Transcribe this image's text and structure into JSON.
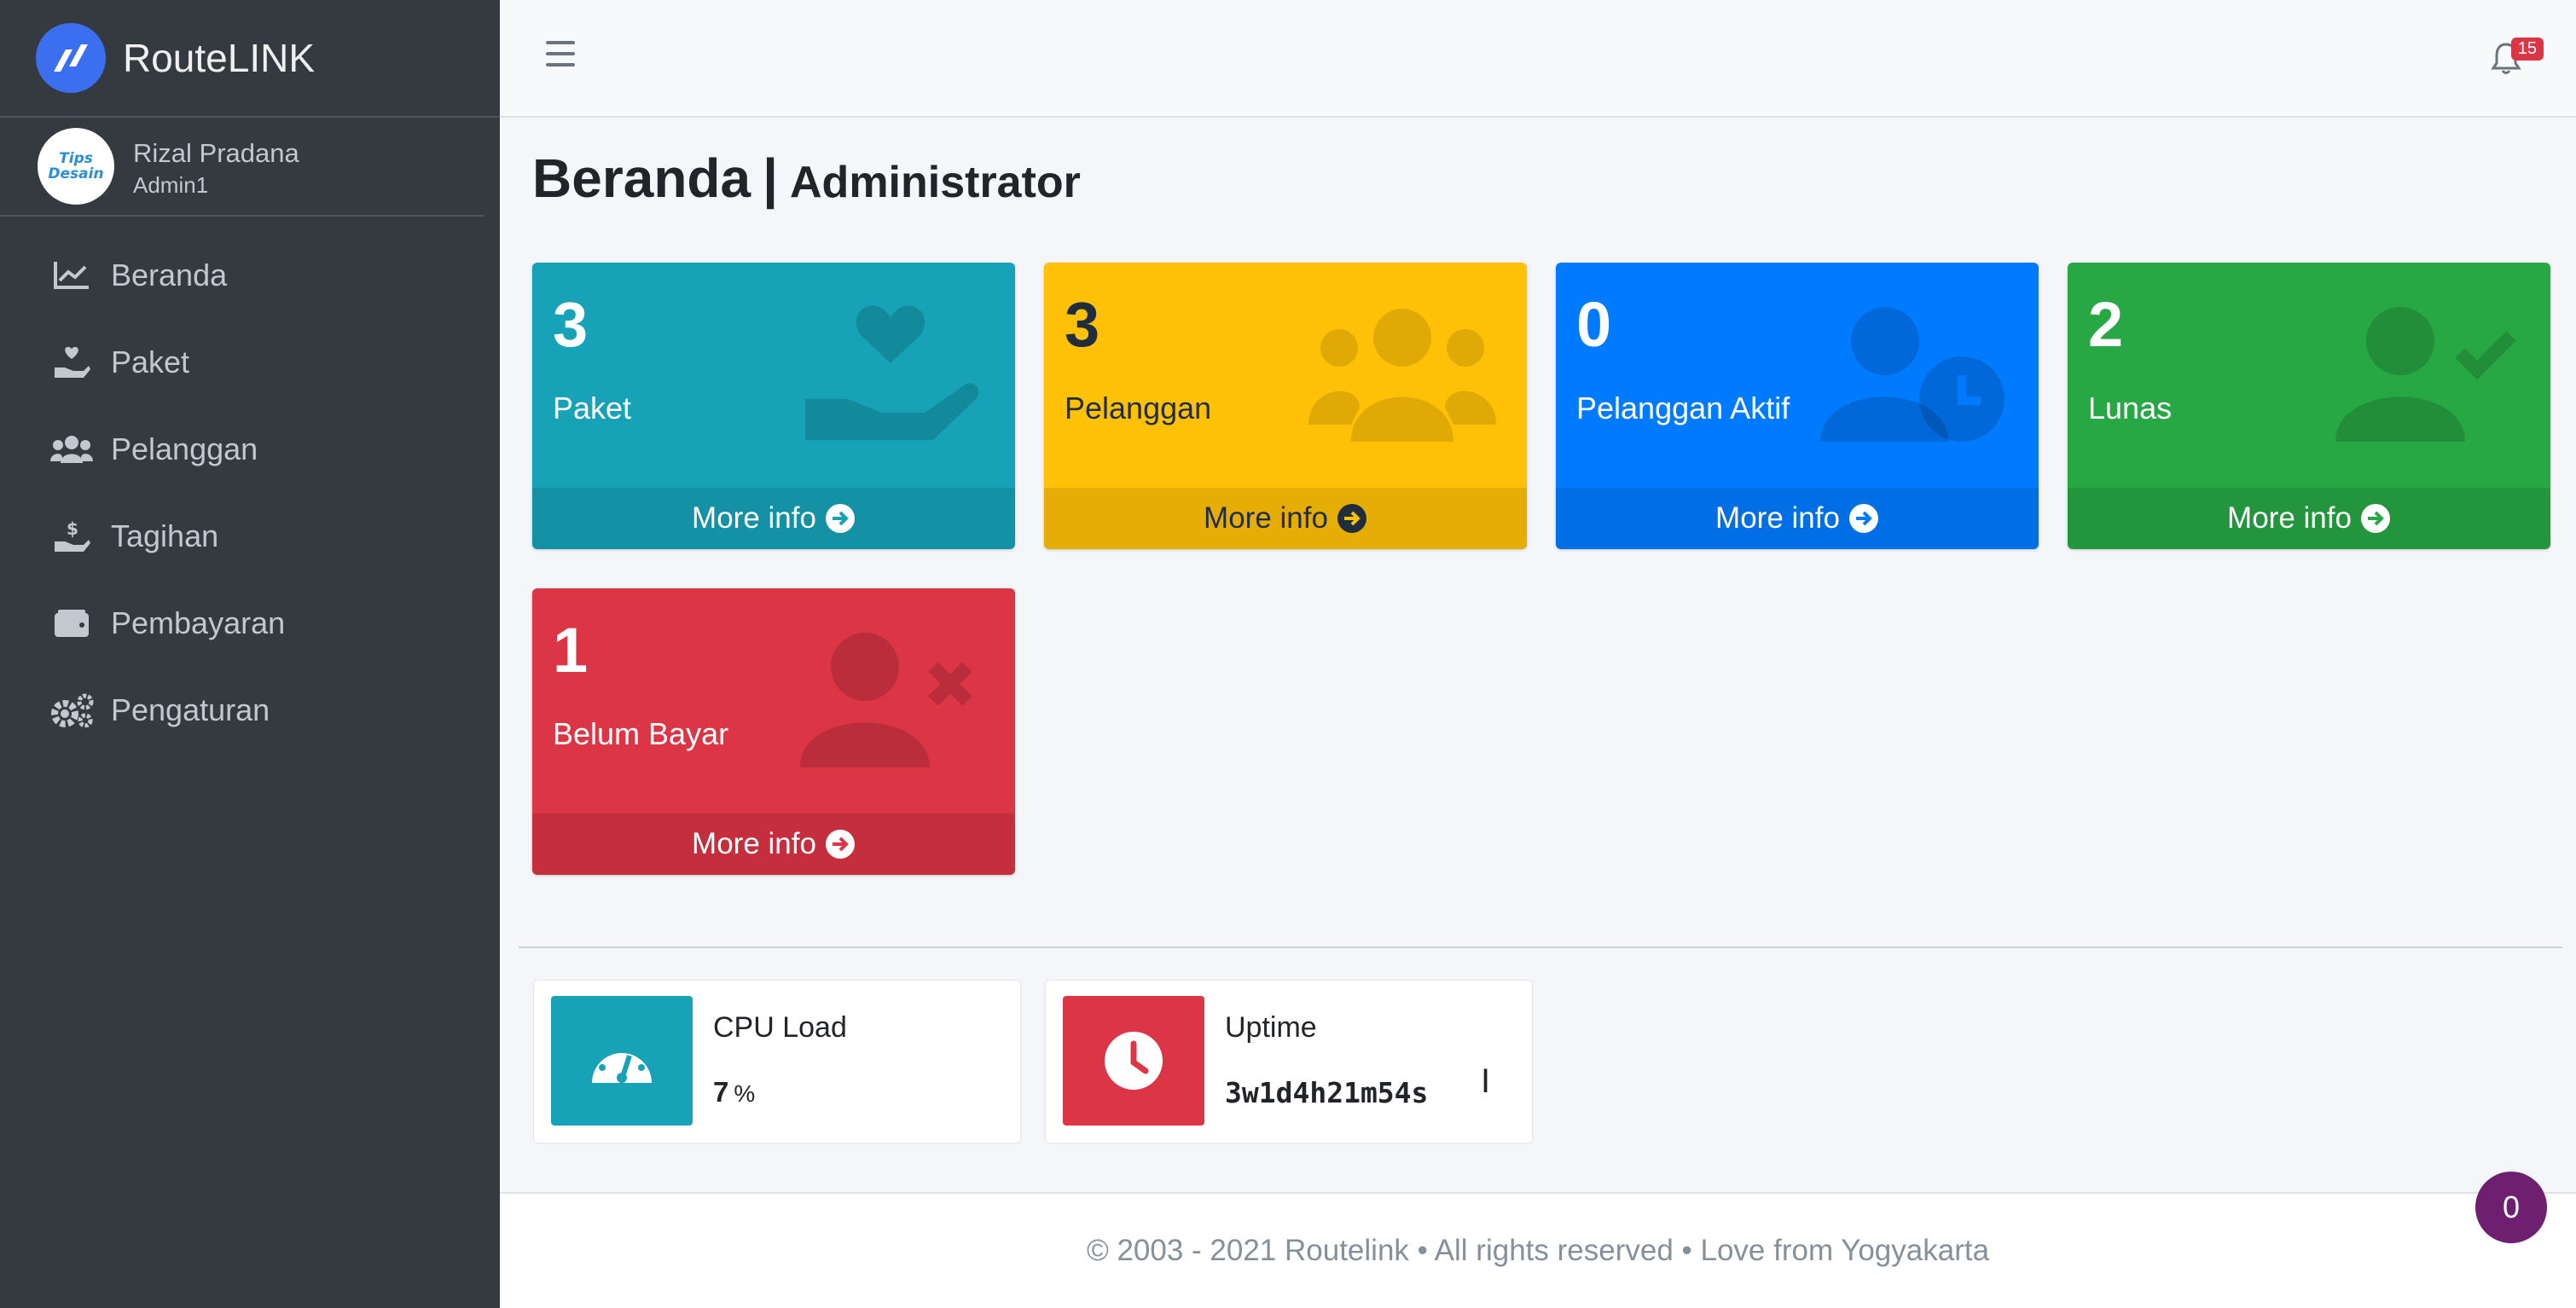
{
  "brand": {
    "name": "RouteLINK"
  },
  "user": {
    "name": "Rizal Pradana",
    "role": "Admin1",
    "avatar_text_1": "Tips",
    "avatar_text_2": "Desain"
  },
  "sidebar": {
    "items": [
      {
        "label": "Beranda",
        "icon": "chart-line-icon"
      },
      {
        "label": "Paket",
        "icon": "hand-heart-icon"
      },
      {
        "label": "Pelanggan",
        "icon": "users-icon"
      },
      {
        "label": "Tagihan",
        "icon": "hand-money-icon"
      },
      {
        "label": "Pembayaran",
        "icon": "wallet-icon"
      },
      {
        "label": "Pengaturan",
        "icon": "gears-icon"
      }
    ]
  },
  "header": {
    "notification_count": "15"
  },
  "page": {
    "title": "Beranda",
    "subtitle": "Administrator"
  },
  "boxes": [
    {
      "value": "3",
      "label": "Paket",
      "more": "More info",
      "color": "#17a2b8"
    },
    {
      "value": "3",
      "label": "Pelanggan",
      "more": "More info",
      "color": "#ffc107"
    },
    {
      "value": "0",
      "label": "Pelanggan Aktif",
      "more": "More info",
      "color": "#007bff"
    },
    {
      "value": "2",
      "label": "Lunas",
      "more": "More info",
      "color": "#28a745"
    },
    {
      "value": "1",
      "label": "Belum Bayar",
      "more": "More info",
      "color": "#dc3545"
    }
  ],
  "info": {
    "cpu": {
      "label": "CPU Load",
      "value": "7",
      "unit": "%"
    },
    "uptime": {
      "label": "Uptime",
      "value": "3w1d4h21m54s"
    }
  },
  "footer": {
    "text": "© 2003 - 2021 Routelink • All rights reserved • Love from Yogyakarta"
  },
  "floating": {
    "count": "0"
  }
}
